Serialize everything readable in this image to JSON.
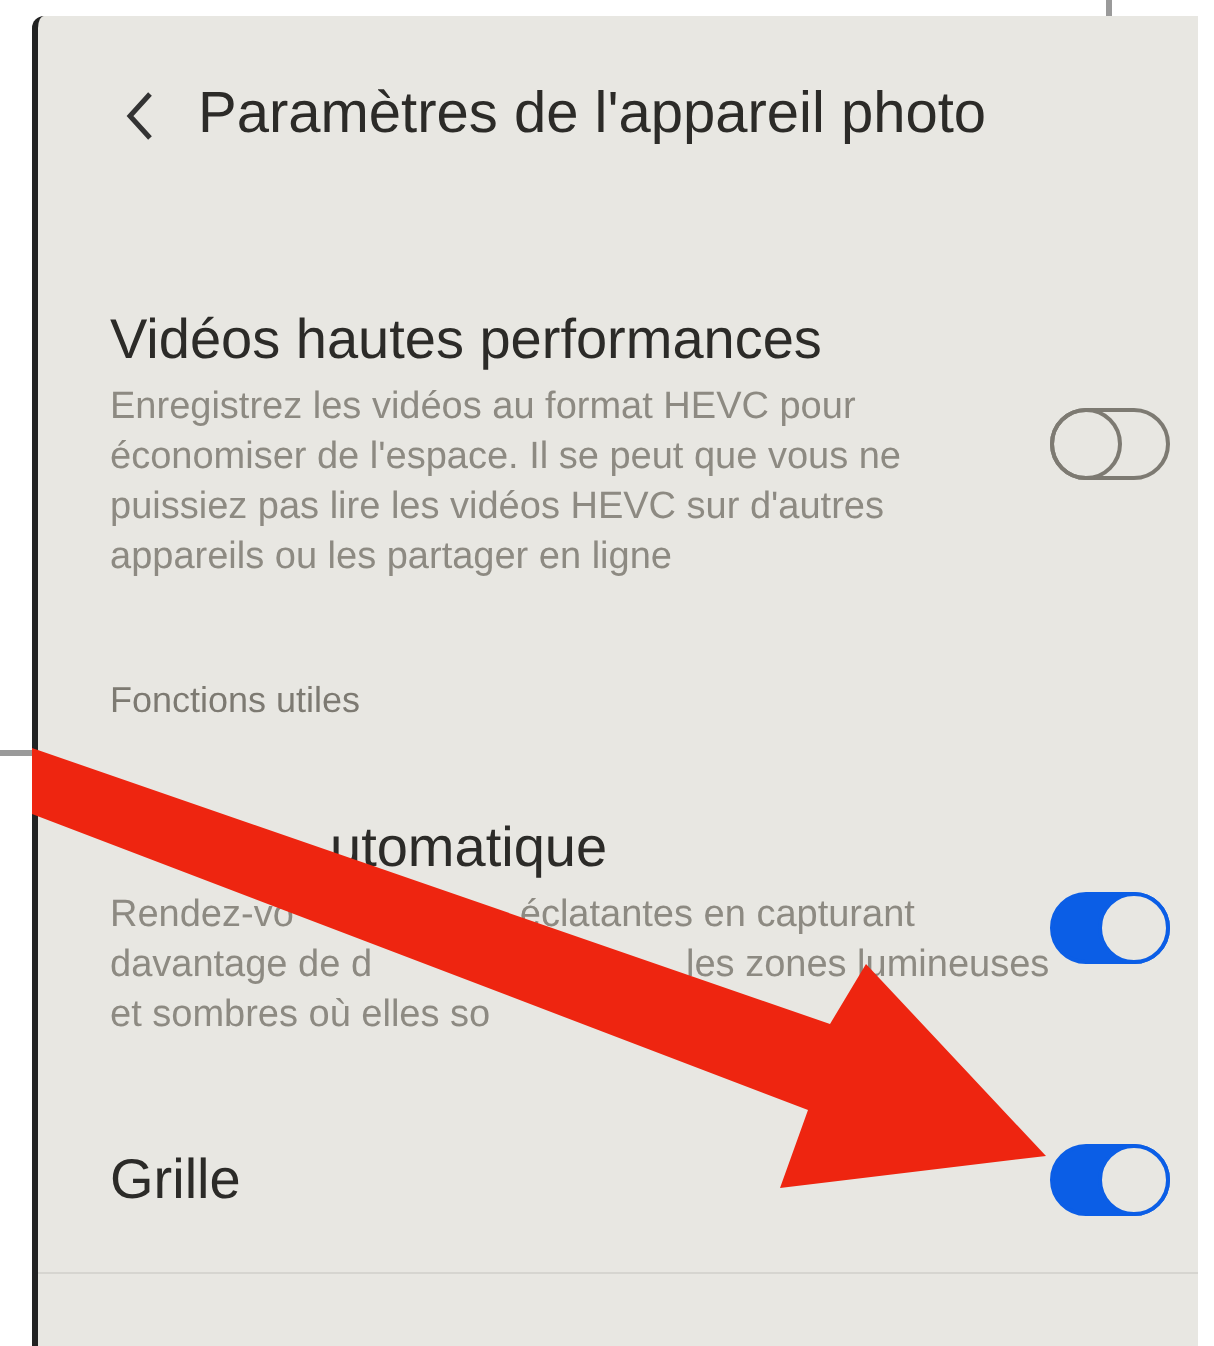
{
  "header": {
    "title": "Paramètres de l'appareil photo"
  },
  "settings": [
    {
      "kind": "toggle",
      "title": "Vidéos hautes performances",
      "description_lines": [
        [
          "Enregistrez les vidéos au format HEVC pour"
        ],
        [
          "économiser de l'espace. Il se peut que vous ne"
        ],
        [
          "puissiez pas lire les vidéos HEVC sur d'autres"
        ],
        [
          "appareils ou les partager en ligne"
        ]
      ],
      "on": false
    },
    {
      "kind": "section",
      "title": "Fonctions utiles"
    },
    {
      "kind": "toggle",
      "title": "utomatique",
      "description_lines": [
        [
          "Rendez-vo",
          "éclatantes en capturant"
        ],
        [
          "davantage de d",
          "les zones lumineuses"
        ],
        [
          "et sombres où elles so"
        ]
      ],
      "on": true
    },
    {
      "kind": "toggle",
      "title": "Grille",
      "on": true
    }
  ]
}
